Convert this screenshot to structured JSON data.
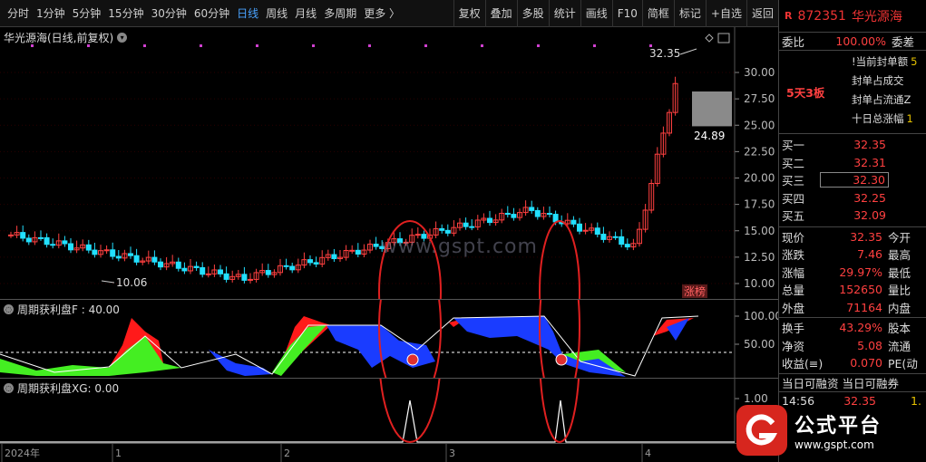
{
  "toolbar": {
    "period_tabs": [
      "分时",
      "1分钟",
      "5分钟",
      "15分钟",
      "30分钟",
      "60分钟",
      "日线",
      "周线",
      "月线",
      "多周期",
      "更多 〉"
    ],
    "active_tab": "日线",
    "buttons": [
      "复权",
      "叠加",
      "多股",
      "统计",
      "画线",
      "F10",
      "简框",
      "标记",
      "+自选",
      "返回"
    ]
  },
  "main_chart": {
    "title": "华光源海(日线,前复权)",
    "y_ticks": [
      "30.00",
      "27.50",
      "25.00",
      "22.50",
      "20.00",
      "17.50",
      "15.00",
      "12.50",
      "10.00"
    ],
    "high_label": "32.35",
    "low_label": "10.06",
    "price_marker": "24.89",
    "tag_label": "涨榜",
    "watermark": "www.gspt.com",
    "colors": {
      "up": "#ff4040",
      "down": "#22e0ff",
      "marker": "#d040d0"
    }
  },
  "indicator1": {
    "title": "周期获利盘F : 40.00",
    "y_ticks": [
      "100.00",
      "50.00"
    ],
    "colors": {
      "red": "#ff1a1a",
      "green": "#44ee22",
      "blue": "#1a3cff",
      "line": "#ffffff"
    }
  },
  "indicator2": {
    "title": "周期获利盘XG: 0.00",
    "y_ticks": [
      "1.00"
    ]
  },
  "x_axis": {
    "labels": [
      "2024年",
      "1",
      "2",
      "3",
      "4"
    ]
  },
  "quote": {
    "r_badge": "R",
    "code": "872351",
    "name": "华光源海",
    "weibi_label": "委比",
    "weibi_value": "100.00%",
    "weicha_label": "委差",
    "seal_tag": "5天3板",
    "seal_lines": [
      {
        "label": "!当前封单额",
        "value": "5"
      },
      {
        "label": "封单占成交",
        "value": ""
      },
      {
        "label": "封单占流通Z",
        "value": ""
      },
      {
        "label": "十日总涨幅",
        "value": "1"
      }
    ],
    "bids": [
      {
        "label": "买一",
        "value": "32.35"
      },
      {
        "label": "买二",
        "value": "32.31"
      },
      {
        "label": "买三",
        "value": "32.30"
      },
      {
        "label": "买四",
        "value": "32.25"
      },
      {
        "label": "买五",
        "value": "32.09"
      }
    ],
    "stats": [
      {
        "label": "现价",
        "value": "32.35",
        "label2": "今开"
      },
      {
        "label": "涨跌",
        "value": "7.46",
        "label2": "最高"
      },
      {
        "label": "涨幅",
        "value": "29.97%",
        "label2": "最低"
      },
      {
        "label": "总量",
        "value": "152650",
        "label2": "量比"
      },
      {
        "label": "外盘",
        "value": "71164",
        "label2": "内盘"
      }
    ],
    "stats2": [
      {
        "label": "换手",
        "value": "43.29%",
        "label2": "股本"
      },
      {
        "label": "净资",
        "value": "5.08",
        "label2": "流通"
      },
      {
        "label": "收益(≡)",
        "value": "0.070",
        "label2": "PE(动"
      }
    ],
    "margin_labels": [
      "当日可融资",
      "当日可融券"
    ],
    "tick": {
      "time": "14:56",
      "price": "32.35",
      "extra": "1."
    }
  },
  "logo": {
    "cn": "公式平台",
    "url": "www.gspt.com"
  }
}
